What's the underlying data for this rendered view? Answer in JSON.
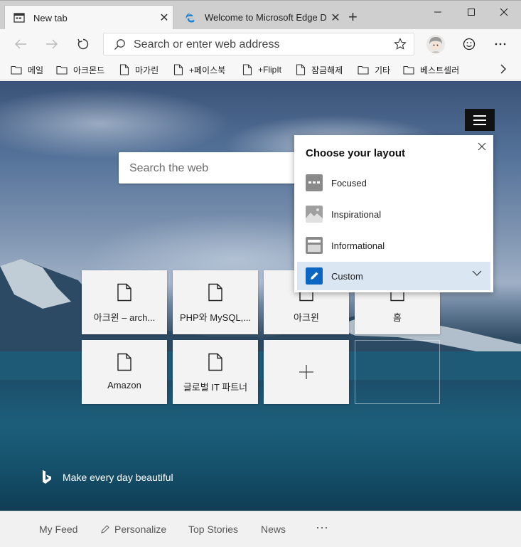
{
  "tabs": [
    {
      "title": "New tab",
      "favicon": "newtab-icon"
    },
    {
      "title": "Welcome to Microsoft Edge Dev",
      "favicon": "edge-icon"
    }
  ],
  "window_controls": [
    "minimize-icon",
    "maximize-icon",
    "close-icon"
  ],
  "address_bar": {
    "placeholder": "Search or enter web address"
  },
  "favorites": [
    {
      "label": "메일",
      "icon": "folder-icon"
    },
    {
      "label": "아크몬드",
      "icon": "folder-icon"
    },
    {
      "label": "마가린",
      "icon": "page-icon"
    },
    {
      "label": "+페이스북",
      "icon": "page-icon"
    },
    {
      "label": "+FlipIt",
      "icon": "page-icon"
    },
    {
      "label": "잠금해제",
      "icon": "page-icon"
    },
    {
      "label": "기타",
      "icon": "folder-icon"
    },
    {
      "label": "베스트셀러",
      "icon": "folder-icon"
    }
  ],
  "page": {
    "search_placeholder": "Search the web",
    "tiles": [
      {
        "label": "아크윈 – arch..."
      },
      {
        "label": "PHP와 MySQL,..."
      },
      {
        "label": "아크윈"
      },
      {
        "label": "홈"
      },
      {
        "label": "Amazon"
      },
      {
        "label": "글로벌 IT 파트너"
      }
    ],
    "bing_caption": "Make every day beautiful"
  },
  "layout_popup": {
    "title": "Choose your layout",
    "options": [
      {
        "label": "Focused",
        "icon": "focused-layout-icon"
      },
      {
        "label": "Inspirational",
        "icon": "inspirational-layout-icon"
      },
      {
        "label": "Informational",
        "icon": "informational-layout-icon"
      },
      {
        "label": "Custom",
        "icon": "custom-layout-icon",
        "selected": true
      }
    ]
  },
  "footer": {
    "items": [
      "My Feed",
      "Personalize",
      "Top Stories",
      "News"
    ],
    "more": "···"
  },
  "colors": {
    "accent": "#0a66c2",
    "selected_bg": "#dbe6f3"
  }
}
